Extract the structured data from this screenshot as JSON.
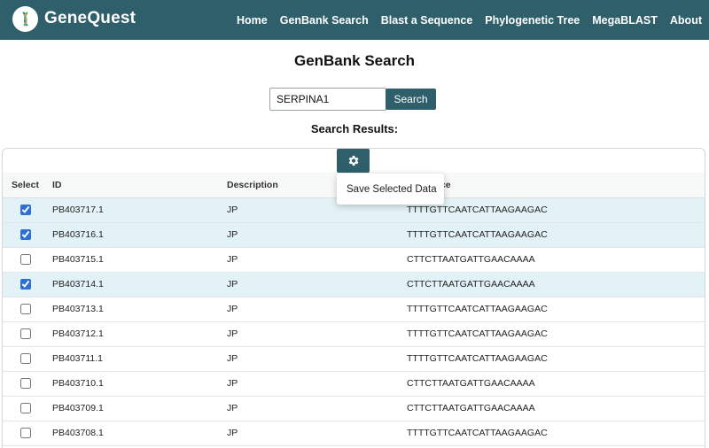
{
  "nav": {
    "brand": "GeneQuest",
    "links": [
      "Home",
      "GenBank Search",
      "Blast a Sequence",
      "Phylogenetic Tree",
      "MegaBLAST",
      "About"
    ]
  },
  "page": {
    "title": "GenBank Search"
  },
  "search": {
    "value": "SERPINA1",
    "button_label": "Search"
  },
  "results": {
    "title": "Search Results:",
    "settings_icon": "gear-icon",
    "menu": {
      "save_label": "Save Selected Data"
    },
    "columns": [
      "Select",
      "ID",
      "Description",
      "Sequence"
    ],
    "rows": [
      {
        "checked": true,
        "id": "PB403717.1",
        "description": "JP",
        "sequence": "TTTTGTTCAATCATTAAGAAGAC"
      },
      {
        "checked": true,
        "id": "PB403716.1",
        "description": "JP",
        "sequence": "TTTTGTTCAATCATTAAGAAGAC"
      },
      {
        "checked": false,
        "id": "PB403715.1",
        "description": "JP",
        "sequence": "CTTCTTAATGATTGAACAAAA"
      },
      {
        "checked": true,
        "id": "PB403714.1",
        "description": "JP",
        "sequence": "CTTCTTAATGATTGAACAAAA"
      },
      {
        "checked": false,
        "id": "PB403713.1",
        "description": "JP",
        "sequence": "TTTTGTTCAATCATTAAGAAGAC"
      },
      {
        "checked": false,
        "id": "PB403712.1",
        "description": "JP",
        "sequence": "TTTTGTTCAATCATTAAGAAGAC"
      },
      {
        "checked": false,
        "id": "PB403711.1",
        "description": "JP",
        "sequence": "TTTTGTTCAATCATTAAGAAGAC"
      },
      {
        "checked": false,
        "id": "PB403710.1",
        "description": "JP",
        "sequence": "CTTCTTAATGATTGAACAAAA"
      },
      {
        "checked": false,
        "id": "PB403709.1",
        "description": "JP",
        "sequence": "CTTCTTAATGATTGAACAAAA"
      },
      {
        "checked": false,
        "id": "PB403708.1",
        "description": "JP",
        "sequence": "TTTTGTTCAATCATTAAGAAGAC"
      }
    ]
  },
  "colors": {
    "nav_bg": "#2e5f6a",
    "selected_row": "#e3f2f6",
    "checkbox": "#2f6fd6"
  }
}
